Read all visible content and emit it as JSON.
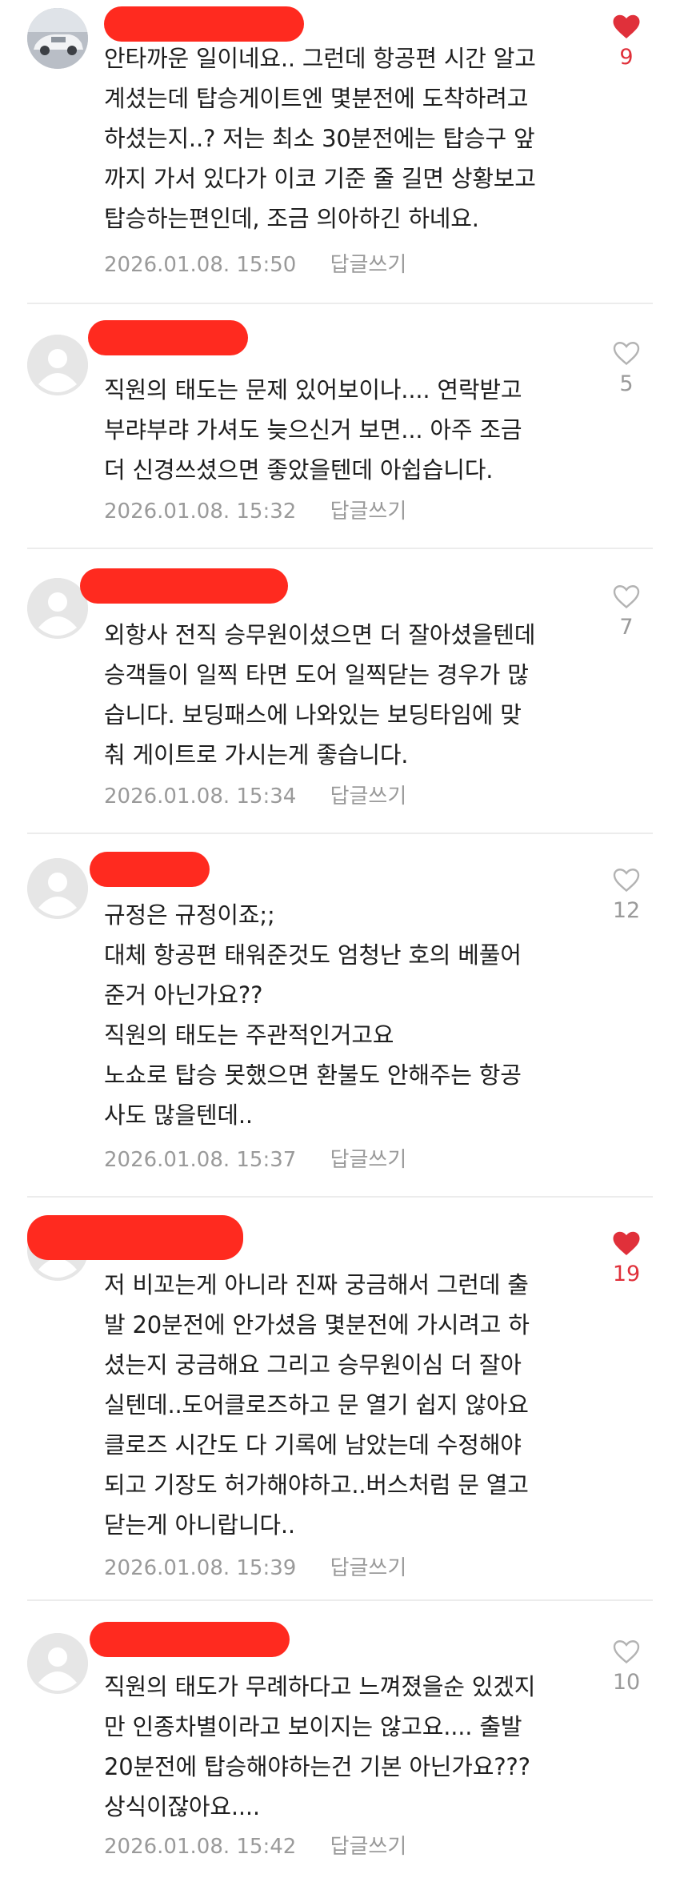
{
  "theme": {
    "liked_color": "#e0303a",
    "redaction_color": "#ff2a1f",
    "muted_text": "#9a9a9a"
  },
  "comments": [
    {
      "avatar": "car-photo",
      "text": "안타까운 일이네요.. 그런데 항공편 시간 알고\n계셨는데 탑승게이트엔 몇분전에 도착하려고\n하셨는지..? 저는 최소 30분전에는 탑승구 앞\n까지 가서 있다가 이코 기준 줄 길면 상황보고\n탑승하는편인데, 조금 의아하긴 하네요.",
      "date": "2026.01.08. 15:50",
      "reply": "답글쓰기",
      "likes": "9",
      "liked": true
    },
    {
      "avatar": "default-user",
      "text": "직원의 태도는 문제 있어보이나.... 연락받고\n부랴부랴 가셔도 늦으신거 보면... 아주 조금\n더 신경쓰셨으면 좋았을텐데 아쉽습니다.",
      "date": "2026.01.08. 15:32",
      "reply": "답글쓰기",
      "likes": "5",
      "liked": false
    },
    {
      "avatar": "default-user",
      "text": "외항사 전직 승무원이셨으면 더 잘아셨을텐데\n승객들이 일찍 타면 도어 일찍닫는 경우가 많\n습니다. 보딩패스에 나와있는 보딩타임에 맞\n춰 게이트로 가시는게 좋습니다.",
      "date": "2026.01.08. 15:34",
      "reply": "답글쓰기",
      "likes": "7",
      "liked": false
    },
    {
      "avatar": "default-user",
      "text": "규정은 규정이죠;;\n대체 항공편 태워준것도 엄청난 호의 베풀어\n준거 아닌가요??\n직원의 태도는 주관적인거고요\n노쇼로 탑승 못했으면 환불도 안해주는 항공\n사도 많을텐데..",
      "date": "2026.01.08. 15:37",
      "reply": "답글쓰기",
      "likes": "12",
      "liked": false
    },
    {
      "avatar": "default-user",
      "text": "저 비꼬는게 아니라 진짜 궁금해서 그런데 출\n발 20분전에 안가셨음 몇분전에 가시려고 하\n셨는지 궁금해요 그리고 승무원이심 더 잘아\n실텐데..도어클로즈하고 문 열기 쉽지 않아요\n클로즈 시간도 다 기록에 남았는데 수정해야\n되고 기장도 허가해야하고..버스처럼 문 열고\n닫는게 아니랍니다..",
      "date": "2026.01.08. 15:39",
      "reply": "답글쓰기",
      "likes": "19",
      "liked": true
    },
    {
      "avatar": "default-user",
      "text": "직원의 태도가 무례하다고 느껴졌을순 있겠지\n만 인종차별이라고 보이지는 않고요.... 출발\n20분전에 탑승해야하는건 기본 아닌가요???\n상식이잖아요....",
      "date": "2026.01.08. 15:42",
      "reply": "답글쓰기",
      "likes": "10",
      "liked": false
    }
  ]
}
